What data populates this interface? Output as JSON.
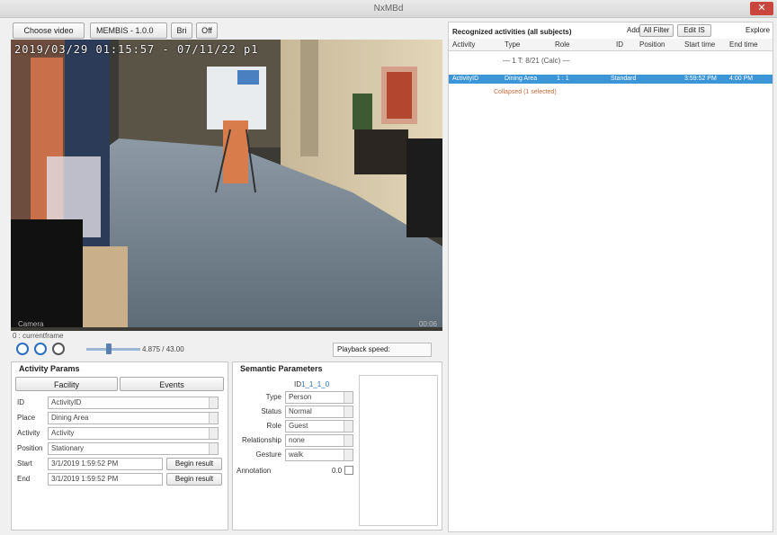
{
  "window": {
    "title": "NxMBd",
    "close_glyph": "✕"
  },
  "toolbar": {
    "choose_video": "Choose video",
    "combo_value": "MEMBIS - 1.0.0",
    "btn2": "Bri",
    "btn3": "Off"
  },
  "video": {
    "timestamp": "2019/03/29  01:15:57 - 07/11/22 p1",
    "corner_left": "Camera",
    "corner_right": "00:06"
  },
  "playback": {
    "caption": "0 : currentframe",
    "time_label": "4.875 / 43.00",
    "speed_label": "Playback speed:",
    "icons": [
      "rewind-icon",
      "play-icon",
      "stop-icon"
    ]
  },
  "activity_params": {
    "title": "Activity Params",
    "tab_left": "Facility",
    "tab_right": "Events",
    "rows": [
      {
        "label": "ID",
        "value": "ActivityID"
      },
      {
        "label": "Place",
        "value": "Dining Area"
      },
      {
        "label": "Activity",
        "value": "Activity"
      },
      {
        "label": "Position",
        "value": "Stationary"
      },
      {
        "label": "Start",
        "value": "3/1/2019 1:59:52 PM",
        "button": "Begin result"
      },
      {
        "label": "End",
        "value": "3/1/2019 1:59:52 PM",
        "button": "Begin result"
      }
    ]
  },
  "semantic_params": {
    "title": "Semantic Parameters",
    "id_label": "ID",
    "id_value": "1_1_1_0",
    "rows": [
      {
        "label": "Type",
        "value": "Person"
      },
      {
        "label": "Status",
        "value": "Normal"
      },
      {
        "label": "Role",
        "value": "Guest"
      },
      {
        "label": "Relationship",
        "value": "none"
      },
      {
        "label": "Gesture",
        "value": "walk"
      }
    ],
    "checkbox_label": "Annotation",
    "checkbox_value": "0.0"
  },
  "events_panel": {
    "title": "Recognized activities (all subjects)",
    "header_controls": [
      "Add",
      "All Filter",
      "Edit IS"
    ],
    "right_button": "Explore",
    "columns": [
      "Activity",
      "Type",
      "Role",
      "ID",
      "Position",
      "Start time",
      "End time"
    ],
    "group_label": "— 1 T: 8/21 (Calc) —",
    "selected_row": [
      "ActivityID",
      "Dining Area",
      "1 : 1",
      "Standard",
      "3:59:52 PM",
      "4:00 PM"
    ],
    "sub_row": "Collapsed (1 selected)"
  },
  "colors": {
    "selection": "#3c95d6",
    "accent": "#2a6ebd",
    "close": "#c9463d"
  }
}
